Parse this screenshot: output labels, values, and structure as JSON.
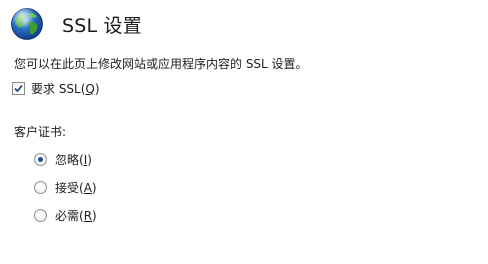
{
  "header": {
    "title": "SSL 设置",
    "icon": "globe-icon"
  },
  "description": "您可以在此页上修改网站或应用程序内容的 SSL 设置。",
  "require_ssl": {
    "label_prefix": "要求 SSL(",
    "accel": "Q",
    "label_suffix": ")",
    "checked": true
  },
  "client_certificates": {
    "label": "客户证书:",
    "options": [
      {
        "prefix": "忽略(",
        "accel": "I",
        "suffix": ")",
        "selected": true
      },
      {
        "prefix": "接受(",
        "accel": "A",
        "suffix": ")",
        "selected": false
      },
      {
        "prefix": "必需(",
        "accel": "R",
        "suffix": ")",
        "selected": false
      }
    ]
  },
  "colors": {
    "accent": "#1f4f9c",
    "globe_ocean": "#2a74c9",
    "globe_land": "#4caf3a"
  }
}
